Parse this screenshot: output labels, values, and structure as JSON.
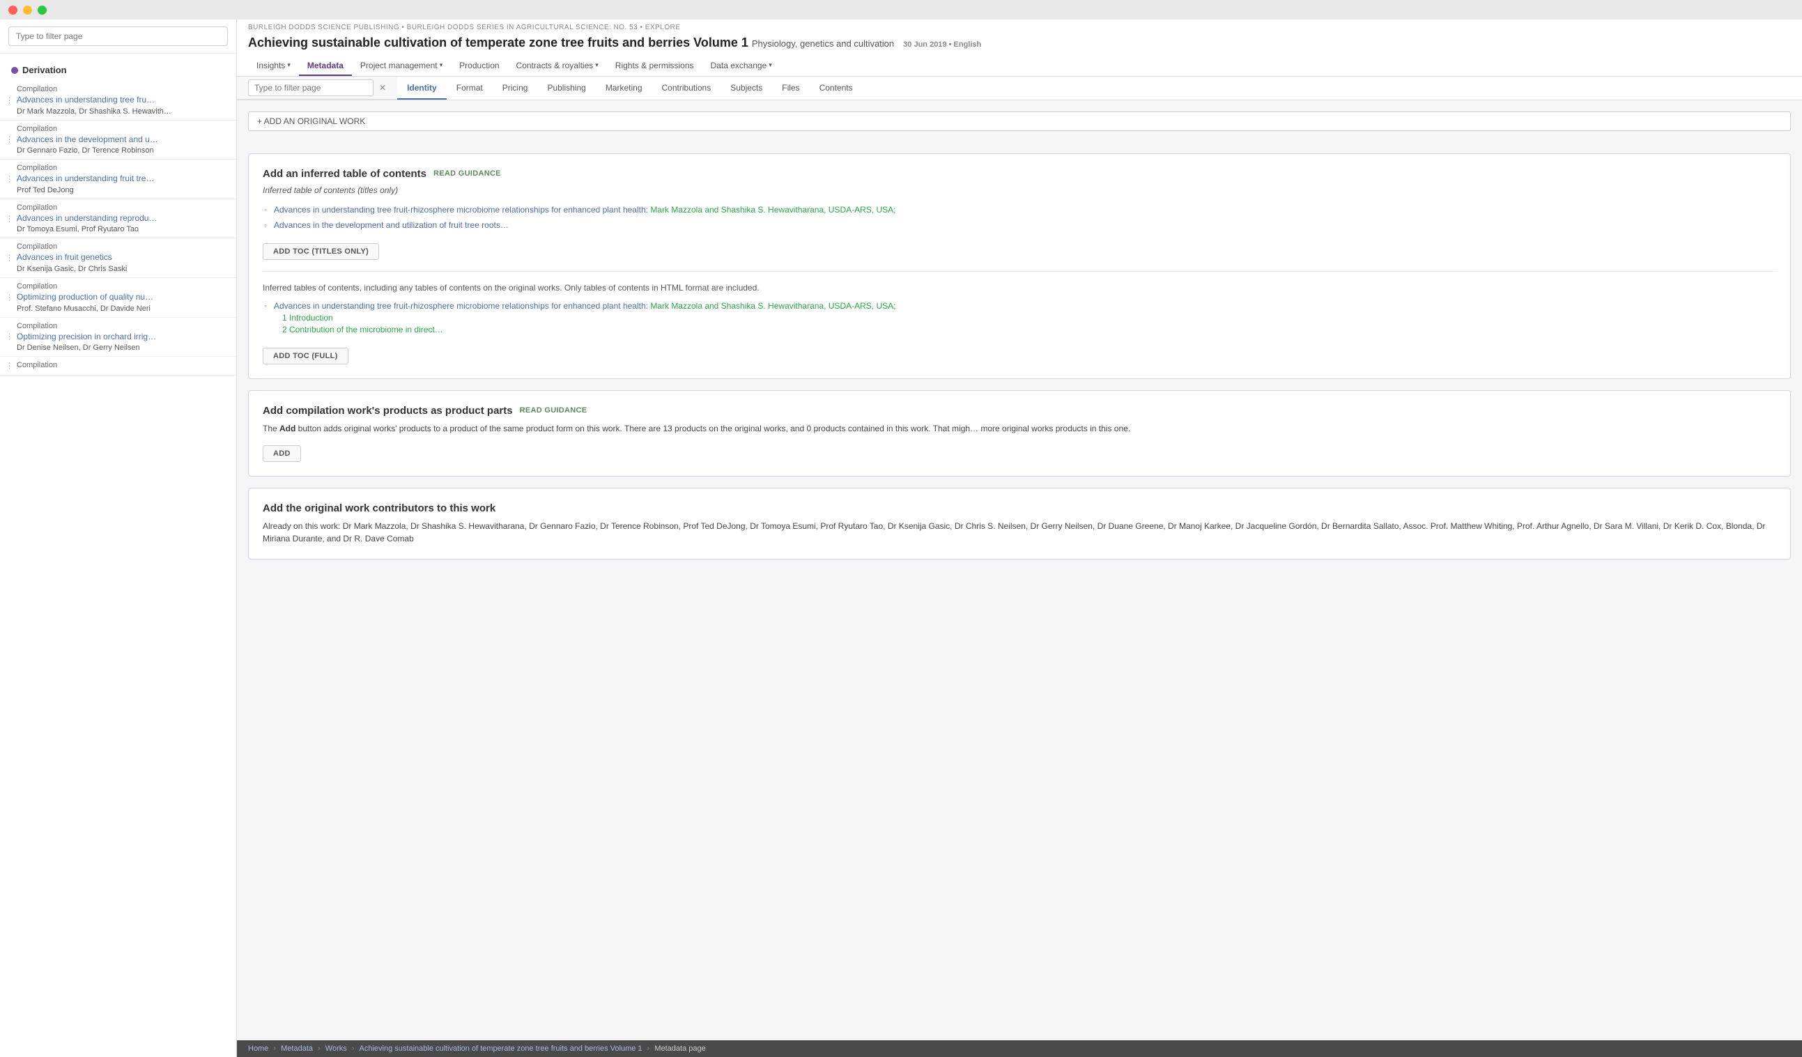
{
  "window": {
    "titlebar": {
      "traffic_lights": [
        "red",
        "yellow",
        "green"
      ]
    }
  },
  "sidebar": {
    "filter_placeholder": "Type to filter page",
    "derivation_label": "Derivation",
    "items": [
      {
        "type": "Compilation",
        "title": "Advances in understanding tree fru…",
        "authors": "Dr Mark Mazzola, Dr Shashika S. Hewavith…"
      },
      {
        "type": "Compilation",
        "title": "Advances in the development and u…",
        "authors": "Dr Gennaro Fazio, Dr Terence Robinson"
      },
      {
        "type": "Compilation",
        "title": "Advances in understanding fruit tre…",
        "authors": "Prof Ted DeJong"
      },
      {
        "type": "Compilation",
        "title": "Advances in understanding reprodu…",
        "authors": "Dr Tomoya Esumi, Prof Ryutaro Tao"
      },
      {
        "type": "Compilation",
        "title": "Advances in fruit genetics",
        "authors": "Dr Ksenija Gasic, Dr Chris Saski"
      },
      {
        "type": "Compilation",
        "title": "Optimizing production of quality nu…",
        "authors": "Prof. Stefano Musacchi, Dr Davide Neri"
      },
      {
        "type": "Compilation",
        "title": "Optimizing precision in orchard irrig…",
        "authors": "Dr Denise Neilsen, Dr Gerry Neilsen"
      },
      {
        "type": "Compilation",
        "title": "",
        "authors": ""
      }
    ]
  },
  "header": {
    "publisher_breadcrumb": "BURLEIGH DODDS SCIENCE PUBLISHING • BURLEIGH DODDS SERIES IN AGRICULTURAL SCIENCE: NO. 53 • EXPLORE",
    "book_title": "Achieving sustainable cultivation of temperate zone tree fruits and berries Volume 1",
    "book_subtitle": "Physiology, genetics and cultivation",
    "book_date": "30 Jun 2019",
    "book_lang": "English",
    "nav_tabs_1": [
      {
        "label": "Insights",
        "has_chevron": true,
        "active": false
      },
      {
        "label": "Metadata",
        "has_chevron": false,
        "active": true
      },
      {
        "label": "Project management",
        "has_chevron": true,
        "active": false
      },
      {
        "label": "Production",
        "has_chevron": false,
        "active": false
      },
      {
        "label": "Contracts & royalties",
        "has_chevron": true,
        "active": false
      },
      {
        "label": "Rights & permissions",
        "has_chevron": false,
        "active": false
      },
      {
        "label": "Data exchange",
        "has_chevron": true,
        "active": false
      }
    ],
    "filter_placeholder": "Type to filter page",
    "nav_tabs_2": [
      {
        "label": "Identity",
        "active": true
      },
      {
        "label": "Format",
        "active": false
      },
      {
        "label": "Pricing",
        "active": false
      },
      {
        "label": "Publishing",
        "active": false
      },
      {
        "label": "Marketing",
        "active": false
      },
      {
        "label": "Contributions",
        "active": false
      },
      {
        "label": "Subjects",
        "active": false
      },
      {
        "label": "Files",
        "active": false
      },
      {
        "label": "Contents",
        "active": false
      }
    ]
  },
  "content": {
    "add_original_work_label": "+ ADD AN ORIGINAL WORK",
    "section1": {
      "heading": "Add an inferred table of contents",
      "read_guidance": "READ GUIDANCE",
      "inferred_label": "Inferred table of contents (titles only)",
      "toc_items_titles": [
        "Advances in understanding tree fruit-rhizosphere microbiome relationships for enhanced plant health: Mark Mazzola and Shashika S. Hewavitharana, USDA-ARS, USA;",
        "Advances in the development and utilization of fruit tree roots…"
      ],
      "add_toc_titles_btn": "ADD TOC (TITLES ONLY)",
      "inferred_full_label": "Inferred tables of contents, including any tables of contents on the original works. Only tables of contents in HTML format are included.",
      "toc_items_full": [
        {
          "main": "Advances in understanding tree fruit-rhizosphere microbiome relationships for enhanced plant health: Mark Mazzola and Shashika S. Hewavitharana, USDA-ARS, USA;",
          "children": [
            "1 Introduction",
            "2 Contribution of the microbiome in direct…"
          ]
        }
      ],
      "add_toc_full_btn": "ADD TOC (FULL)"
    },
    "section2": {
      "heading": "Add compilation work's products as product parts",
      "read_guidance": "READ GUIDANCE",
      "body": "The Add button adds original works' products to a product of the same product form on this work. There are 13 products on the original works, and 0 products contained in this work. That migh… more original works products in this one.",
      "add_btn": "ADD"
    },
    "section3": {
      "heading": "Add the original work contributors to this work",
      "body": "Already on this work: Dr Mark Mazzola, Dr Shashika S. Hewavitharana, Dr Gennaro Fazio, Dr Terence Robinson, Prof Ted DeJong, Dr Tomoya Esumi, Prof Ryutaro Tao, Dr Ksenija Gasic, Dr Chris S. Neilsen, Dr Gerry Neilsen, Dr Duane Greene, Dr Manoj Karkee, Dr Jacqueline Gordón, Dr Bernardita Sallato, Assoc. Prof. Matthew Whiting, Prof. Arthur Agnello, Dr Sara M. Villani, Dr Kerik D. Cox, Blonda, Dr Miriana Durante, and Dr R. Dave Comab"
    }
  },
  "bottom_bar": {
    "items": [
      {
        "label": "Home",
        "link": true
      },
      {
        "label": "Metadata",
        "link": true
      },
      {
        "label": "Works",
        "link": true
      },
      {
        "label": "Achieving sustainable cultivation of temperate zone tree fruits and berries Volume 1",
        "link": true
      },
      {
        "label": "Metadata page",
        "link": false
      }
    ]
  }
}
